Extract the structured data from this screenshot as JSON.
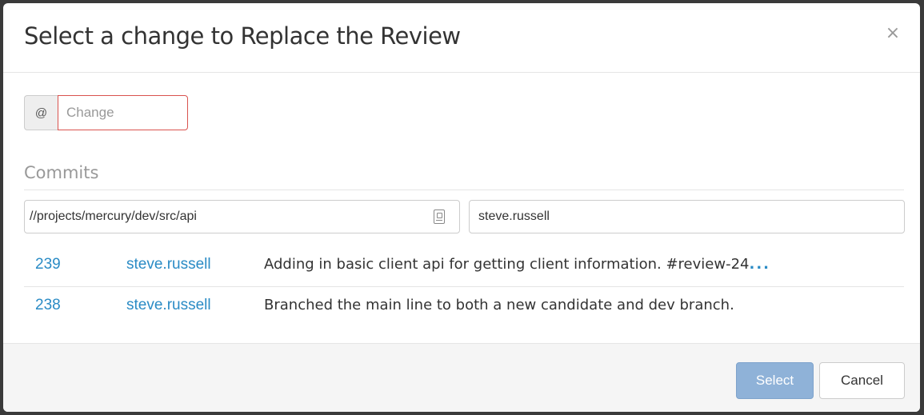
{
  "dialog": {
    "title": "Select a change to Replace the Review",
    "close_glyph": "×"
  },
  "change_field": {
    "addon": "@",
    "placeholder": "Change",
    "value": ""
  },
  "commits": {
    "heading": "Commits",
    "path_filter": "//projects/mercury/dev/src/api",
    "user_filter": "steve.russell",
    "rows": [
      {
        "id": "239",
        "user": "steve.russell",
        "description": "Adding in basic client api for getting client information. #review-24",
        "more": "..."
      },
      {
        "id": "238",
        "user": "steve.russell",
        "description": "Branched the main line to both a new candidate and dev branch.",
        "more": ""
      }
    ]
  },
  "footer": {
    "select_label": "Select",
    "cancel_label": "Cancel"
  },
  "colors": {
    "link": "#2a8bc5",
    "primary_disabled": "#8fb2d8",
    "error_border": "#d9534f"
  }
}
